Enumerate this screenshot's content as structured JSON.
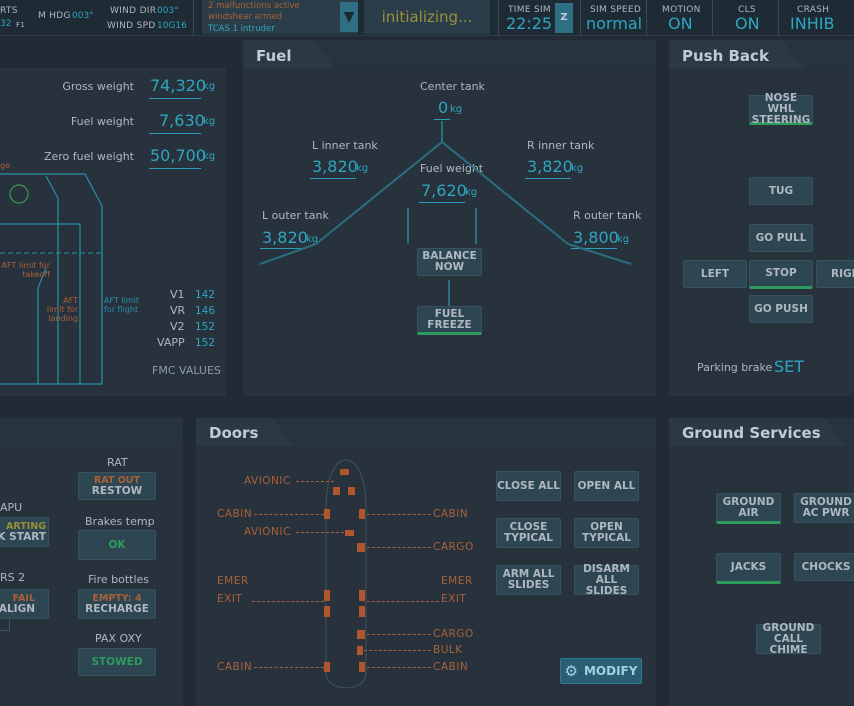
{
  "top": {
    "partial_left": "RTS",
    "partial_left2": "32",
    "partial_f": "F1",
    "mhdg": "M HDG",
    "mhdg_val": "003°",
    "wind_dir": "WIND DIR",
    "wind_dir_val": "003°",
    "wind_spd": "WIND SPD",
    "wind_spd_val": "10G16",
    "msg1": "2 malfunctions active",
    "msg2": "windshear armed",
    "msg3": "TCAS 1 intruder",
    "status": "initializing...",
    "time_sim": "TIME SIM",
    "time_val": "22:25",
    "time_z": "Z",
    "sim_speed": "SIM SPEED",
    "sim_speed_val": "normal",
    "motion": "MOTION",
    "motion_val": "ON",
    "cls": "CLS",
    "cls_val": "ON",
    "crash": "CRASH",
    "crash_val": "INHIB"
  },
  "weights": {
    "gross_label": "Gross weight",
    "gross": "74,320",
    "fuel_label": "Fuel weight",
    "fuel": "7,630",
    "zfw_label": "Zero fuel weight",
    "zfw": "50,700",
    "unit": "kg",
    "partial": "ge",
    "aft_fwd": "AFT limit for takeoff",
    "aft_land": "AFT limit for landing",
    "aft_flight": "AFT limit for flight",
    "v1": "V1",
    "v1_val": "142",
    "vr": "VR",
    "vr_val": "146",
    "v2": "V2",
    "v2_val": "152",
    "vapp": "VAPP",
    "vapp_val": "152",
    "fmc": "FMC VALUES"
  },
  "fuel": {
    "title": "Fuel",
    "center_label": "Center tank",
    "center": "0",
    "l_inner_label": "L inner tank",
    "l_inner": "3,820",
    "r_inner_label": "R inner tank",
    "r_inner": "3,820",
    "fuel_weight_label": "Fuel weight",
    "fuel_weight": "7,620",
    "l_outer_label": "L  outer tank",
    "l_outer": "3,820",
    "r_outer_label": "R outer tank",
    "r_outer": "3,800",
    "unit": "kg",
    "balance": "BALANCE NOW",
    "freeze": "FUEL FREEZE"
  },
  "pushback": {
    "title": "Push Back",
    "nose": "NOSE WHL STEERING",
    "tug": "TUG",
    "go_pull": "GO PULL",
    "left": "LEFT",
    "stop": "STOP",
    "right": "RIGH",
    "go_push": "GO PUSH",
    "parking_label": "Parking brake",
    "parking_val": "SET"
  },
  "left_bottom": {
    "rat": "RAT",
    "rat_btn1": "RAT OUT",
    "rat_btn2": "RESTOW",
    "apu": "APU",
    "apu_btn1": "ARTING",
    "apu_btn2": "K START",
    "brakes": "Brakes temp",
    "brakes_val": "OK",
    "rs2": "RS 2",
    "rs2_btn1": "FAIL",
    "rs2_btn2": "ALIGN",
    "fire": "Fire bottles",
    "fire_btn1": "EMPTY: 4",
    "fire_btn2": "RECHARGE",
    "pax": "PAX OXY",
    "pax_val": "STOWED"
  },
  "doors": {
    "title": "Doors",
    "avionic1": "AVIONIC",
    "cabin1l": "CABIN",
    "cabin1r": "CABIN",
    "avionic2": "AVIONIC",
    "cargo1": "CARGO",
    "emer_l": "EMER",
    "exit_l": "EXIT",
    "emer_r": "EMER",
    "exit_r": "EXIT",
    "cargo2": "CARGO",
    "bulk": "BULK",
    "cabin2l": "CABIN",
    "cabin2r": "CABIN",
    "close_all": "CLOSE ALL",
    "open_all": "OPEN ALL",
    "close_typ": "CLOSE TYPICAL",
    "open_typ": "OPEN TYPICAL",
    "arm": "ARM ALL SLIDES",
    "disarm": "DISARM ALL SLIDES",
    "modify": "MODIFY"
  },
  "ground": {
    "title": "Ground Services",
    "air": "GROUND AIR",
    "ac": "GROUND AC PWR",
    "jacks": "JACKS",
    "chocks": "CHOCKS",
    "chime": "GROUND CALL CHIME"
  }
}
